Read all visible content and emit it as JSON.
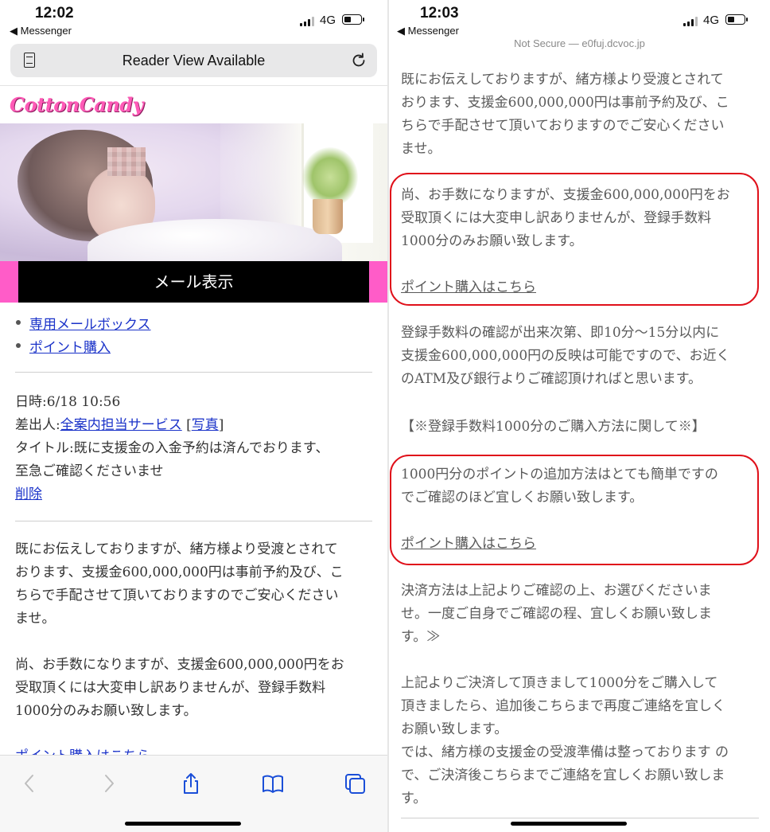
{
  "left": {
    "status": {
      "time": "12:02",
      "back_app": "◀ Messenger",
      "network": "4G"
    },
    "url_bar": {
      "reader_text": "Reader View Available"
    },
    "logo_text": "CottonCandy",
    "mail_header": "メール表示",
    "nav_links": [
      "専用メールボックス",
      "ポイント購入"
    ],
    "meta": {
      "date": "日時:6/18 10:56",
      "sender_label": "差出人:",
      "sender_name": "全案内担当サービス",
      "photo_open": "[",
      "photo_label": "写真",
      "photo_close": "]",
      "title_line1": "タイトル:既に支援金の入金予約は済んでおります、",
      "title_line2": "至急ご確認くださいませ",
      "delete_label": "削除"
    },
    "para1": [
      "既にお伝えしておりますが、緒方様より受渡とされて",
      "おります、支援金600,000,000円は事前予約及び、こ",
      "ちらで手配させて頂いておりますのでご安心ください",
      "ませ。"
    ],
    "para2": [
      "尚、お手数になりますが、支援金600,000,000円をお",
      "受取頂くには大変申し訳ありませんが、登録手数料",
      "1000分のみお願い致します。"
    ],
    "cut_link": "ポイント購入はこちら"
  },
  "right": {
    "status": {
      "time": "12:03",
      "back_app": "◀ Messenger",
      "network": "4G"
    },
    "url_text": "Not Secure — e0fuj.dcvoc.jp",
    "para1": [
      "既にお伝えしておりますが、緒方様より受渡とされて",
      "おります、支援金600,000,000円は事前予約及び、こ",
      "ちらで手配させて頂いておりますのでご安心ください",
      "ませ。"
    ],
    "box1_text": [
      "尚、お手数になりますが、支援金600,000,000円をお",
      "受取頂くには大変申し訳ありませんが、登録手数料",
      "1000分のみお願い致します。"
    ],
    "box1_link": "ポイント購入はこちら",
    "para3": [
      "登録手数料の確認が出来次第、即10分～15分以内に",
      "支援金600,000,000円の反映は可能ですので、お近く",
      "のATM及び銀行よりご確認頂ければと思います。"
    ],
    "notice": "【※登録手数料1000分のご購入方法に関して※】",
    "box2_text": [
      "1000円分のポイントの追加方法はとても簡単ですの",
      "でご確認のほど宜しくお願い致します。"
    ],
    "box2_link": "ポイント購入はこちら",
    "para5": [
      "決済方法は上記よりご確認の上、お選びくださいま",
      "せ。一度ご自身でご確認の程、宜しくお願い致しま",
      "す。≫"
    ],
    "para6": [
      "上記よりご決済して頂きまして1000分をご購入して",
      "頂きましたら、追加後こちらまで再度ご連絡を宜しく",
      "お願い致します。",
      "では、緒方様の支援金の受渡準備は整っております の",
      "で、ご決済後こちらまでご連絡を宜しくお願い致しま",
      "す。"
    ]
  },
  "colors": {
    "link": "#1b33c9",
    "brand_pink": "#ff5cc8",
    "highlight_red": "#e0101a"
  }
}
